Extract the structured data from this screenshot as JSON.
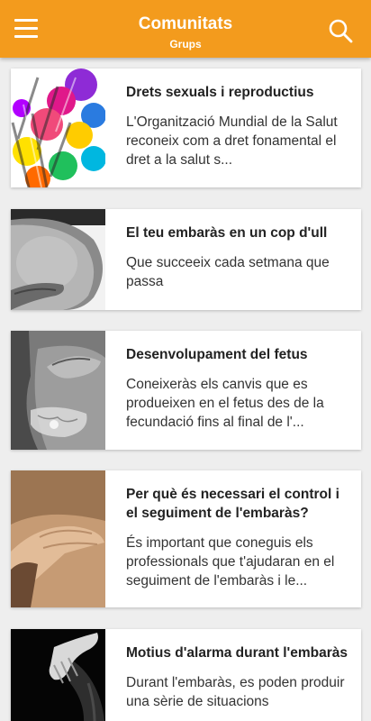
{
  "header": {
    "title": "Comunitats",
    "subtitle": "Grups",
    "color": "#f39b1d",
    "menu_icon": "menu-icon",
    "search_icon": "search-icon"
  },
  "items": [
    {
      "title": "Drets sexuals i reproductius",
      "description": "L'Organització Mundial de la Salut reconeix com a dret fonamental el dret a la salut s..."
    },
    {
      "title": "El teu embaràs en un cop d'ull",
      "description": "Que succeeix cada setmana que passa"
    },
    {
      "title": "Desenvolupament del fetus",
      "description": "Coneixeràs els canvis que es produeixen en el fetus des de la fecundació fins al final de l'..."
    },
    {
      "title": "Per què és necessari el control i el seguiment de l'embaràs?",
      "description": "És important que coneguis els professionals que t'ajudaran en el seguiment de l'embaràs i le..."
    },
    {
      "title": "Motius d'alarma durant l'embaràs",
      "description": "Durant l'embaràs, es poden produir una sèrie de situacions"
    }
  ]
}
